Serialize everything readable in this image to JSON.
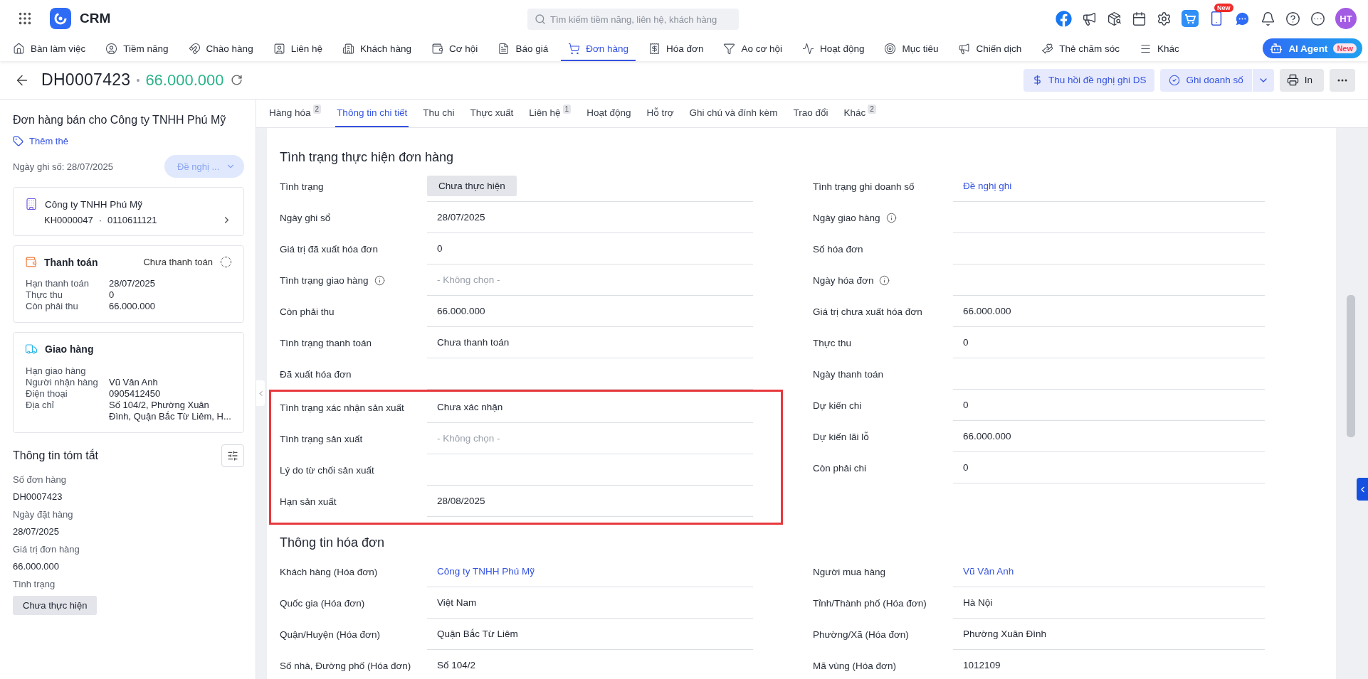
{
  "app": {
    "name": "CRM",
    "search": {
      "placeholder": "Tìm kiếm tiềm năng, liên hệ, khách hàng"
    },
    "badge": "New",
    "avatar": "HT"
  },
  "nav": [
    {
      "label": "Bàn làm việc",
      "selected": false
    },
    {
      "label": "Tiềm năng",
      "selected": false
    },
    {
      "label": "Chào hàng",
      "selected": false
    },
    {
      "label": "Liên hệ",
      "selected": false
    },
    {
      "label": "Khách hàng",
      "selected": false
    },
    {
      "label": "Cơ hội",
      "selected": false
    },
    {
      "label": "Báo giá",
      "selected": false
    },
    {
      "label": "Đơn hàng",
      "selected": true
    },
    {
      "label": "Hóa đơn",
      "selected": false
    },
    {
      "label": "Ao cơ hội",
      "selected": false
    },
    {
      "label": "Hoạt động",
      "selected": false
    },
    {
      "label": "Mục tiêu",
      "selected": false
    },
    {
      "label": "Chiến dịch",
      "selected": false
    },
    {
      "label": "Thẻ chăm sóc",
      "selected": false
    },
    {
      "label": "Khác",
      "selected": false
    }
  ],
  "ai_agent": {
    "label": "AI Agent",
    "badge": "New"
  },
  "record": {
    "code": "DH0007423",
    "separator": "•",
    "amount": "66.000.000"
  },
  "actions": [
    {
      "kind": "soft",
      "label": "Thu hồi đề nghị ghi DS"
    },
    {
      "kind": "split",
      "label": "Ghi doanh số"
    },
    {
      "kind": "grey",
      "label": "In"
    },
    {
      "kind": "more"
    }
  ],
  "sidebar": {
    "title": "Đơn hàng bán cho Công ty TNHH Phú Mỹ",
    "tag_link": "Thêm thẻ",
    "posted_date": "Ngày ghi số: 28/07/2025",
    "status_dropdown": "Đề nghị ...",
    "customer": {
      "name": "Công ty TNHH Phú Mỹ",
      "code": "KH0000047",
      "dot": "·",
      "tax_code": "0110611121"
    },
    "payment": {
      "title": "Thanh toán",
      "status": "Chưa thanh toán",
      "rows": [
        {
          "label": "Hạn thanh toán",
          "value": "28/07/2025"
        },
        {
          "label": "Thực thu",
          "value": "0"
        },
        {
          "label": "Còn phải thu",
          "value": "66.000.000"
        }
      ]
    },
    "delivery": {
      "title": "Giao hàng",
      "rows": [
        {
          "label": "Hạn giao hàng"
        },
        {
          "label": "Người nhận hàng",
          "value": "Vũ Vân Anh"
        },
        {
          "label": "Điện thoại",
          "value": "0905412450"
        },
        {
          "label": "Địa chỉ",
          "value": "Số 104/2, Phường Xuân Đình, Quận Bắc Từ Liêm, H..."
        }
      ]
    },
    "summary": {
      "title": "Thông tin tóm tắt",
      "fields": [
        {
          "label": "Số đơn hàng",
          "value": "DH0007423",
          "kind": "text"
        },
        {
          "label": "Ngày đặt hàng",
          "value": "28/07/2025",
          "kind": "text"
        },
        {
          "label": "Giá trị đơn hàng",
          "value": "66.000.000",
          "kind": "text"
        },
        {
          "label": "Tình trạng",
          "value": "Chưa thực hiện",
          "kind": "badge"
        }
      ]
    }
  },
  "tabs": [
    {
      "label": "Hàng hóa",
      "count": "2",
      "selected": false
    },
    {
      "label": "Thông tin chi tiết",
      "selected": true
    },
    {
      "label": "Thu chi",
      "selected": false
    },
    {
      "label": "Thực xuất",
      "selected": false
    },
    {
      "label": "Liên hệ",
      "count": "1",
      "selected": false
    },
    {
      "label": "Hoạt động",
      "selected": false
    },
    {
      "label": "Hỗ trợ",
      "selected": false
    },
    {
      "label": "Ghi chú và đính kèm",
      "selected": false
    },
    {
      "label": "Trao đổi",
      "selected": false
    },
    {
      "label": "Khác",
      "count": "2",
      "selected": false
    }
  ],
  "sections": [
    {
      "title": "Tình trạng thực hiện đơn hàng",
      "left": [
        {
          "highlighted": false,
          "fields": [
            {
              "label": "Tình trạng",
              "kind": "badge",
              "value": "Chưa thực hiện",
              "info": false
            },
            {
              "label": "Ngày ghi sổ",
              "kind": "text",
              "value": "28/07/2025",
              "info": false
            },
            {
              "label": "Giá trị đã xuất hóa đơn",
              "kind": "text",
              "value": "0",
              "info": false
            },
            {
              "label": "Tình trạng giao hàng",
              "kind": "placeholder",
              "placeholder": "- Không chọn -",
              "info": true
            },
            {
              "label": "Còn phải thu",
              "kind": "text",
              "value": "66.000.000",
              "info": false
            },
            {
              "label": "Tình trạng thanh toán",
              "kind": "text",
              "value": "Chưa thanh toán",
              "info": false
            },
            {
              "label": "Đã xuất hóa đơn",
              "kind": "empty",
              "info": false
            }
          ]
        },
        {
          "highlighted": true,
          "fields": [
            {
              "label": "Tình trạng xác nhận sản xuất",
              "kind": "text",
              "value": "Chưa xác nhận",
              "info": false
            },
            {
              "label": "Tình trạng sản xuất",
              "kind": "placeholder",
              "placeholder": "- Không chọn -",
              "info": false
            },
            {
              "label": "Lý do từ chối sản xuất",
              "kind": "empty",
              "info": false
            },
            {
              "label": "Hạn sản xuất",
              "kind": "text",
              "value": "28/08/2025",
              "info": false
            }
          ]
        }
      ],
      "right": [
        {
          "highlighted": false,
          "fields": [
            {
              "label": "Tình trạng ghi doanh số",
              "kind": "link",
              "value": "Đề nghị ghi",
              "info": false
            },
            {
              "label": "Ngày giao hàng",
              "kind": "empty",
              "info": true
            },
            {
              "label": "Số hóa đơn",
              "kind": "empty",
              "info": false
            },
            {
              "label": "Ngày hóa đơn",
              "kind": "empty",
              "info": true
            },
            {
              "label": "Giá trị chưa xuất hóa đơn",
              "kind": "text",
              "value": "66.000.000",
              "info": false
            },
            {
              "label": "Thực thu",
              "kind": "text",
              "value": "0",
              "info": false
            },
            {
              "label": "Ngày thanh toán",
              "kind": "empty",
              "info": false
            },
            {
              "label": "Dự kiến chi",
              "kind": "text",
              "value": "0",
              "info": false
            },
            {
              "label": "Dự kiến lãi lỗ",
              "kind": "text",
              "value": "66.000.000",
              "info": false
            },
            {
              "label": "Còn phải chi",
              "kind": "text",
              "value": "0",
              "info": false
            }
          ]
        }
      ]
    },
    {
      "title": "Thông tin hóa đơn",
      "left": [
        {
          "highlighted": false,
          "fields": [
            {
              "label": "Khách hàng (Hóa đơn)",
              "kind": "link",
              "value": "Công ty TNHH Phú Mỹ",
              "info": false
            },
            {
              "label": "Quốc gia (Hóa đơn)",
              "kind": "text",
              "value": "Việt Nam",
              "info": false
            },
            {
              "label": "Quận/Huyện (Hóa đơn)",
              "kind": "text",
              "value": "Quận Bắc Từ Liêm",
              "info": false
            },
            {
              "label": "Số nhà, Đường phố (Hóa đơn)",
              "kind": "text",
              "value": "Số 104/2",
              "info": false
            }
          ]
        }
      ],
      "right": [
        {
          "highlighted": false,
          "fields": [
            {
              "label": "Người mua hàng",
              "kind": "link",
              "value": "Vũ Vân Anh",
              "info": false
            },
            {
              "label": "Tỉnh/Thành phố (Hóa đơn)",
              "kind": "text",
              "value": "Hà Nội",
              "info": false
            },
            {
              "label": "Phường/Xã (Hóa đơn)",
              "kind": "text",
              "value": "Phường Xuân Đình",
              "info": false
            },
            {
              "label": "Mã vùng (Hóa đơn)",
              "kind": "text",
              "value": "1012109",
              "info": false
            }
          ]
        }
      ]
    }
  ]
}
